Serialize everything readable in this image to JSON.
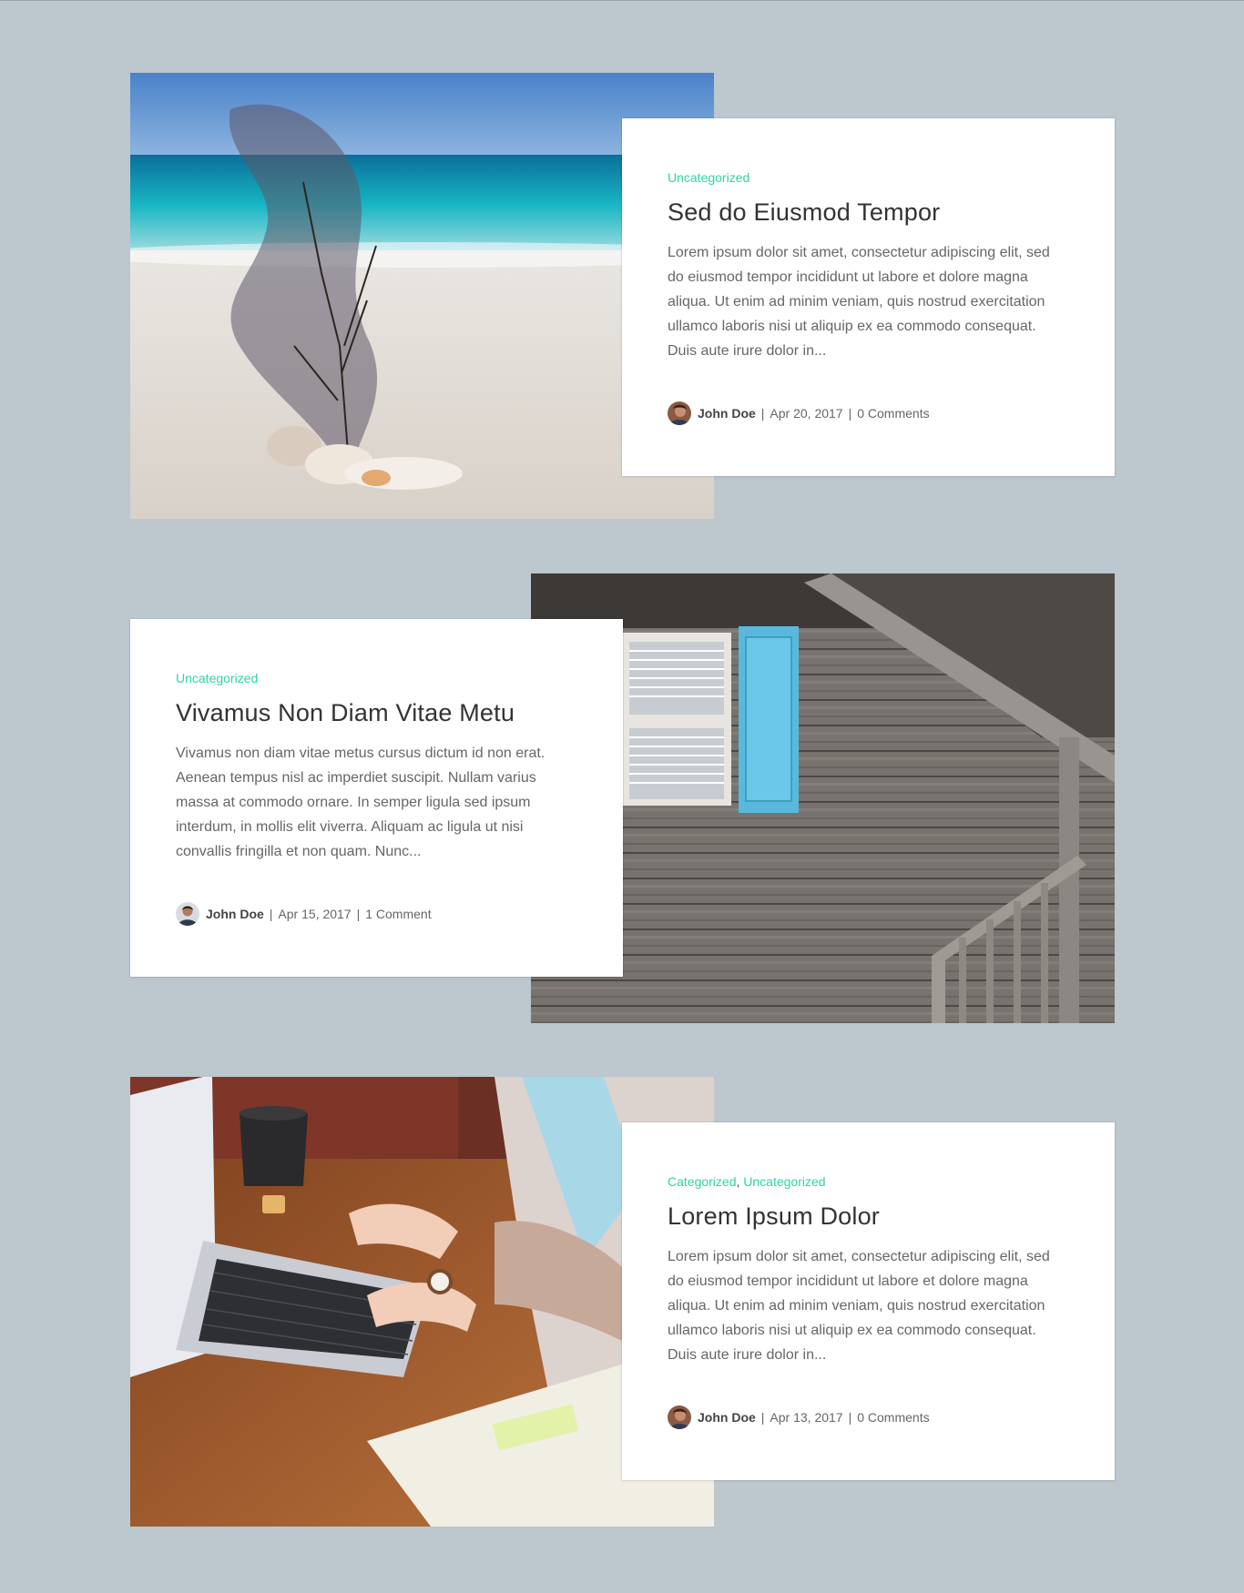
{
  "posts": [
    {
      "categories": [
        "Uncategorized"
      ],
      "title": "Sed do Eiusmod Tempor",
      "excerpt": "Lorem ipsum dolor sit amet, consectetur adipiscing elit, sed do eiusmod tempor incididunt ut labore et dolore magna aliqua. Ut enim ad minim veniam, quis nostrud exercitation ullamco laboris nisi ut aliquip ex ea commodo consequat. Duis aute irure dolor in...",
      "author": "John Doe",
      "date": "Apr 20, 2017",
      "comments": "0 Comments",
      "separator": "|"
    },
    {
      "categories": [
        "Uncategorized"
      ],
      "title": "Vivamus Non Diam Vitae Metu",
      "excerpt": "Vivamus non diam vitae metus cursus dictum id non erat. Aenean tempus nisl ac imperdiet suscipit. Nullam varius massa at commodo ornare. In semper ligula sed ipsum interdum, in mollis elit viverra. Aliquam ac ligula ut nisi convallis fringilla et non quam. Nunc...",
      "author": "John Doe",
      "date": "Apr 15, 2017",
      "comments": "1 Comment",
      "separator": "|"
    },
    {
      "categories": [
        "Categorized",
        "Uncategorized"
      ],
      "category_separator": ",",
      "title": "Lorem Ipsum Dolor",
      "excerpt": "Lorem ipsum dolor sit amet, consectetur adipiscing elit, sed do eiusmod tempor incididunt ut labore et dolore magna aliqua. Ut enim ad minim veniam, quis nostrud exercitation ullamco laboris nisi ut aliquip ex ea commodo consequat. Duis aute irure dolor in...",
      "author": "John Doe",
      "date": "Apr 13, 2017",
      "comments": "0 Comments",
      "separator": "|"
    }
  ],
  "colors": {
    "background": "#bcc7ce",
    "category_link": "#2ed4a4",
    "title": "#333333",
    "text": "#666666"
  },
  "icons": [
    "sea-fan-photo",
    "wooden-house-photo",
    "laptop-desk-photo",
    "author-avatar"
  ]
}
